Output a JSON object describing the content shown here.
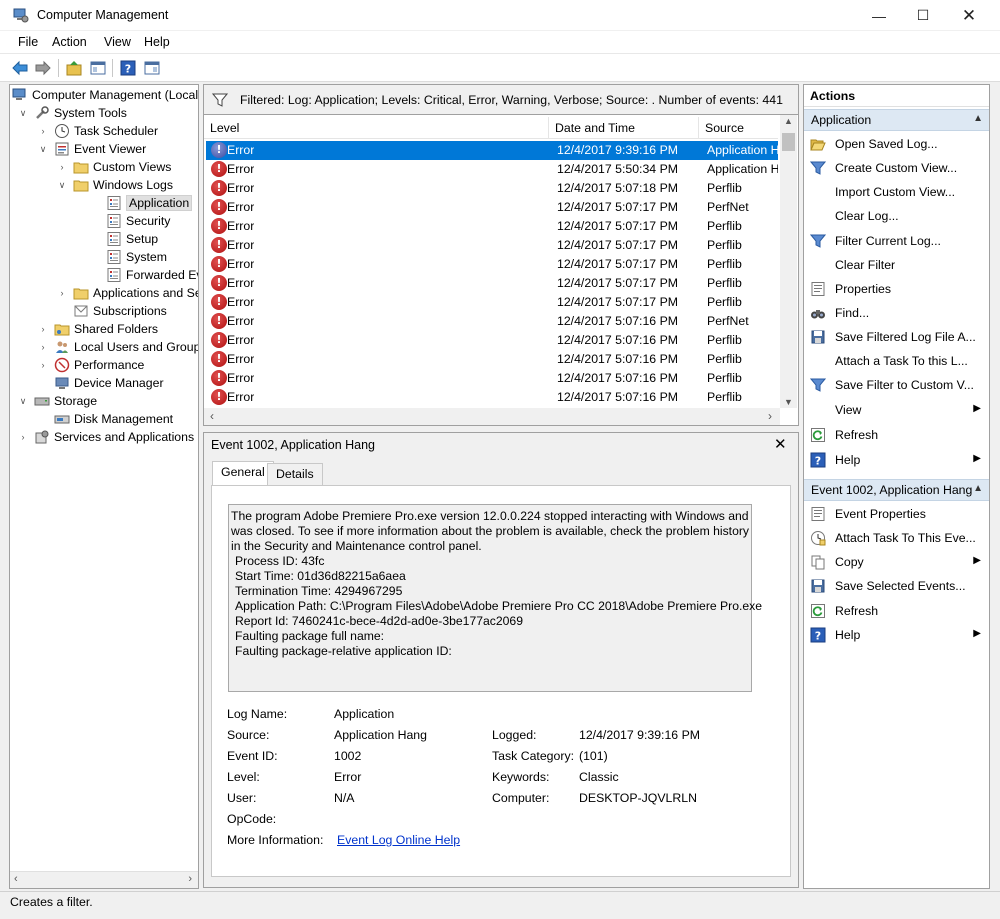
{
  "window": {
    "title": "Computer Management"
  },
  "menu": [
    "File",
    "Action",
    "View",
    "Help"
  ],
  "tree": [
    {
      "label": "Computer Management (Local",
      "indent": 0,
      "exp": "",
      "icon": "computer-icon"
    },
    {
      "label": "System Tools",
      "indent": 1,
      "exp": "▾",
      "icon": "tools-icon"
    },
    {
      "label": "Task Scheduler",
      "indent": 2,
      "exp": "›",
      "icon": "clock-icon"
    },
    {
      "label": "Event Viewer",
      "indent": 2,
      "exp": "▾",
      "icon": "event-viewer-icon"
    },
    {
      "label": "Custom Views",
      "indent": 3,
      "exp": "›",
      "icon": "folder-icon"
    },
    {
      "label": "Windows Logs",
      "indent": 3,
      "exp": "▾",
      "icon": "folder-icon"
    },
    {
      "label": "Application",
      "indent": 4,
      "exp": "",
      "icon": "log-icon",
      "selected": true
    },
    {
      "label": "Security",
      "indent": 4,
      "exp": "",
      "icon": "log-icon"
    },
    {
      "label": "Setup",
      "indent": 4,
      "exp": "",
      "icon": "log-icon"
    },
    {
      "label": "System",
      "indent": 4,
      "exp": "",
      "icon": "log-icon"
    },
    {
      "label": "Forwarded Event",
      "indent": 4,
      "exp": "",
      "icon": "log-icon"
    },
    {
      "label": "Applications and Se",
      "indent": 3,
      "exp": "›",
      "icon": "folder-icon"
    },
    {
      "label": "Subscriptions",
      "indent": 3,
      "exp": "",
      "icon": "subscriptions-icon"
    },
    {
      "label": "Shared Folders",
      "indent": 2,
      "exp": "›",
      "icon": "shared-folder-icon"
    },
    {
      "label": "Local Users and Groups",
      "indent": 2,
      "exp": "›",
      "icon": "users-icon"
    },
    {
      "label": "Performance",
      "indent": 2,
      "exp": "›",
      "icon": "performance-icon"
    },
    {
      "label": "Device Manager",
      "indent": 2,
      "exp": "",
      "icon": "device-manager-icon"
    },
    {
      "label": "Storage",
      "indent": 1,
      "exp": "▾",
      "icon": "storage-icon"
    },
    {
      "label": "Disk Management",
      "indent": 2,
      "exp": "",
      "icon": "disk-icon"
    },
    {
      "label": "Services and Applications",
      "indent": 1,
      "exp": "›",
      "icon": "services-icon"
    }
  ],
  "filter": {
    "text": "Filtered: Log: Application; Levels: Critical, Error, Warning, Verbose; Source: . Number of events: 441"
  },
  "events": {
    "columns": [
      "Level",
      "Date and Time",
      "Source"
    ],
    "rows": [
      {
        "level": "Error",
        "datetime": "12/4/2017 9:39:16 PM",
        "source": "Application H",
        "selected": true
      },
      {
        "level": "Error",
        "datetime": "12/4/2017 5:50:34 PM",
        "source": "Application H"
      },
      {
        "level": "Error",
        "datetime": "12/4/2017 5:07:18 PM",
        "source": "Perflib"
      },
      {
        "level": "Error",
        "datetime": "12/4/2017 5:07:17 PM",
        "source": "PerfNet"
      },
      {
        "level": "Error",
        "datetime": "12/4/2017 5:07:17 PM",
        "source": "Perflib"
      },
      {
        "level": "Error",
        "datetime": "12/4/2017 5:07:17 PM",
        "source": "Perflib"
      },
      {
        "level": "Error",
        "datetime": "12/4/2017 5:07:17 PM",
        "source": "Perflib"
      },
      {
        "level": "Error",
        "datetime": "12/4/2017 5:07:17 PM",
        "source": "Perflib"
      },
      {
        "level": "Error",
        "datetime": "12/4/2017 5:07:17 PM",
        "source": "Perflib"
      },
      {
        "level": "Error",
        "datetime": "12/4/2017 5:07:16 PM",
        "source": "PerfNet"
      },
      {
        "level": "Error",
        "datetime": "12/4/2017 5:07:16 PM",
        "source": "Perflib"
      },
      {
        "level": "Error",
        "datetime": "12/4/2017 5:07:16 PM",
        "source": "Perflib"
      },
      {
        "level": "Error",
        "datetime": "12/4/2017 5:07:16 PM",
        "source": "Perflib"
      },
      {
        "level": "Error",
        "datetime": "12/4/2017 5:07:16 PM",
        "source": "Perflib"
      }
    ]
  },
  "details": {
    "title": "Event 1002, Application Hang",
    "tabs": [
      "General",
      "Details"
    ],
    "description": [
      "The program Adobe Premiere Pro.exe version 12.0.0.224 stopped interacting with Windows and",
      "was closed. To see if more information about the problem is available, check the problem history",
      "in the Security and Maintenance control panel.",
      "Process ID: 43fc",
      "Start Time: 01d36d82215a6aea",
      "Termination Time: 4294967295",
      "Application Path: C:\\Program Files\\Adobe\\Adobe Premiere Pro CC 2018\\Adobe Premiere Pro.exe",
      "Report Id: 7460241c-bece-4d2d-ad0e-3be177ac2069",
      "Faulting package full name:",
      "Faulting package-relative application ID:"
    ],
    "props": {
      "log_name_label": "Log Name:",
      "log_name": "Application",
      "source_label": "Source:",
      "source": "Application Hang",
      "logged_label": "Logged:",
      "logged": "12/4/2017 9:39:16 PM",
      "event_id_label": "Event ID:",
      "event_id": "1002",
      "task_category_label": "Task Category:",
      "task_category": "(101)",
      "level_label": "Level:",
      "level": "Error",
      "keywords_label": "Keywords:",
      "keywords": "Classic",
      "user_label": "User:",
      "user": "N/A",
      "computer_label": "Computer:",
      "computer": "DESKTOP-JQVLRLN",
      "opcode_label": "OpCode:",
      "more_info_label": "More Information:",
      "more_info_link": "Event Log Online Help"
    }
  },
  "actions": {
    "header": "Actions",
    "section1": {
      "title": "Application",
      "items": [
        {
          "label": "Open Saved Log...",
          "icon": "open-folder-icon"
        },
        {
          "label": "Create Custom View...",
          "icon": "filter-icon"
        },
        {
          "label": "Import Custom View...",
          "icon": ""
        },
        {
          "label": "Clear Log...",
          "icon": ""
        },
        {
          "label": "Filter Current Log...",
          "icon": "filter-icon"
        },
        {
          "label": "Clear Filter",
          "icon": ""
        },
        {
          "label": "Properties",
          "icon": "properties-icon"
        },
        {
          "label": "Find...",
          "icon": "binoculars-icon"
        },
        {
          "label": "Save Filtered Log File A...",
          "icon": "save-icon"
        },
        {
          "label": "Attach a Task To this L...",
          "icon": ""
        },
        {
          "label": "Save Filter to Custom V...",
          "icon": "filter-icon"
        },
        {
          "label": "View",
          "icon": "",
          "submenu": true
        },
        {
          "label": "Refresh",
          "icon": "refresh-icon"
        },
        {
          "label": "Help",
          "icon": "help-icon",
          "submenu": true
        }
      ]
    },
    "section2": {
      "title": "Event 1002, Application Hang",
      "items": [
        {
          "label": "Event Properties",
          "icon": "properties-icon"
        },
        {
          "label": "Attach Task To This Eve...",
          "icon": "task-icon"
        },
        {
          "label": "Copy",
          "icon": "copy-icon",
          "submenu": true
        },
        {
          "label": "Save Selected Events...",
          "icon": "save-icon"
        },
        {
          "label": "Refresh",
          "icon": "refresh-icon"
        },
        {
          "label": "Help",
          "icon": "help-icon",
          "submenu": true
        }
      ]
    }
  },
  "status": {
    "text": "Creates a filter."
  },
  "colors": {
    "selection": "#0078d7",
    "section_header": "#dde8f3",
    "link": "#0033cc",
    "error": "#c01818"
  }
}
